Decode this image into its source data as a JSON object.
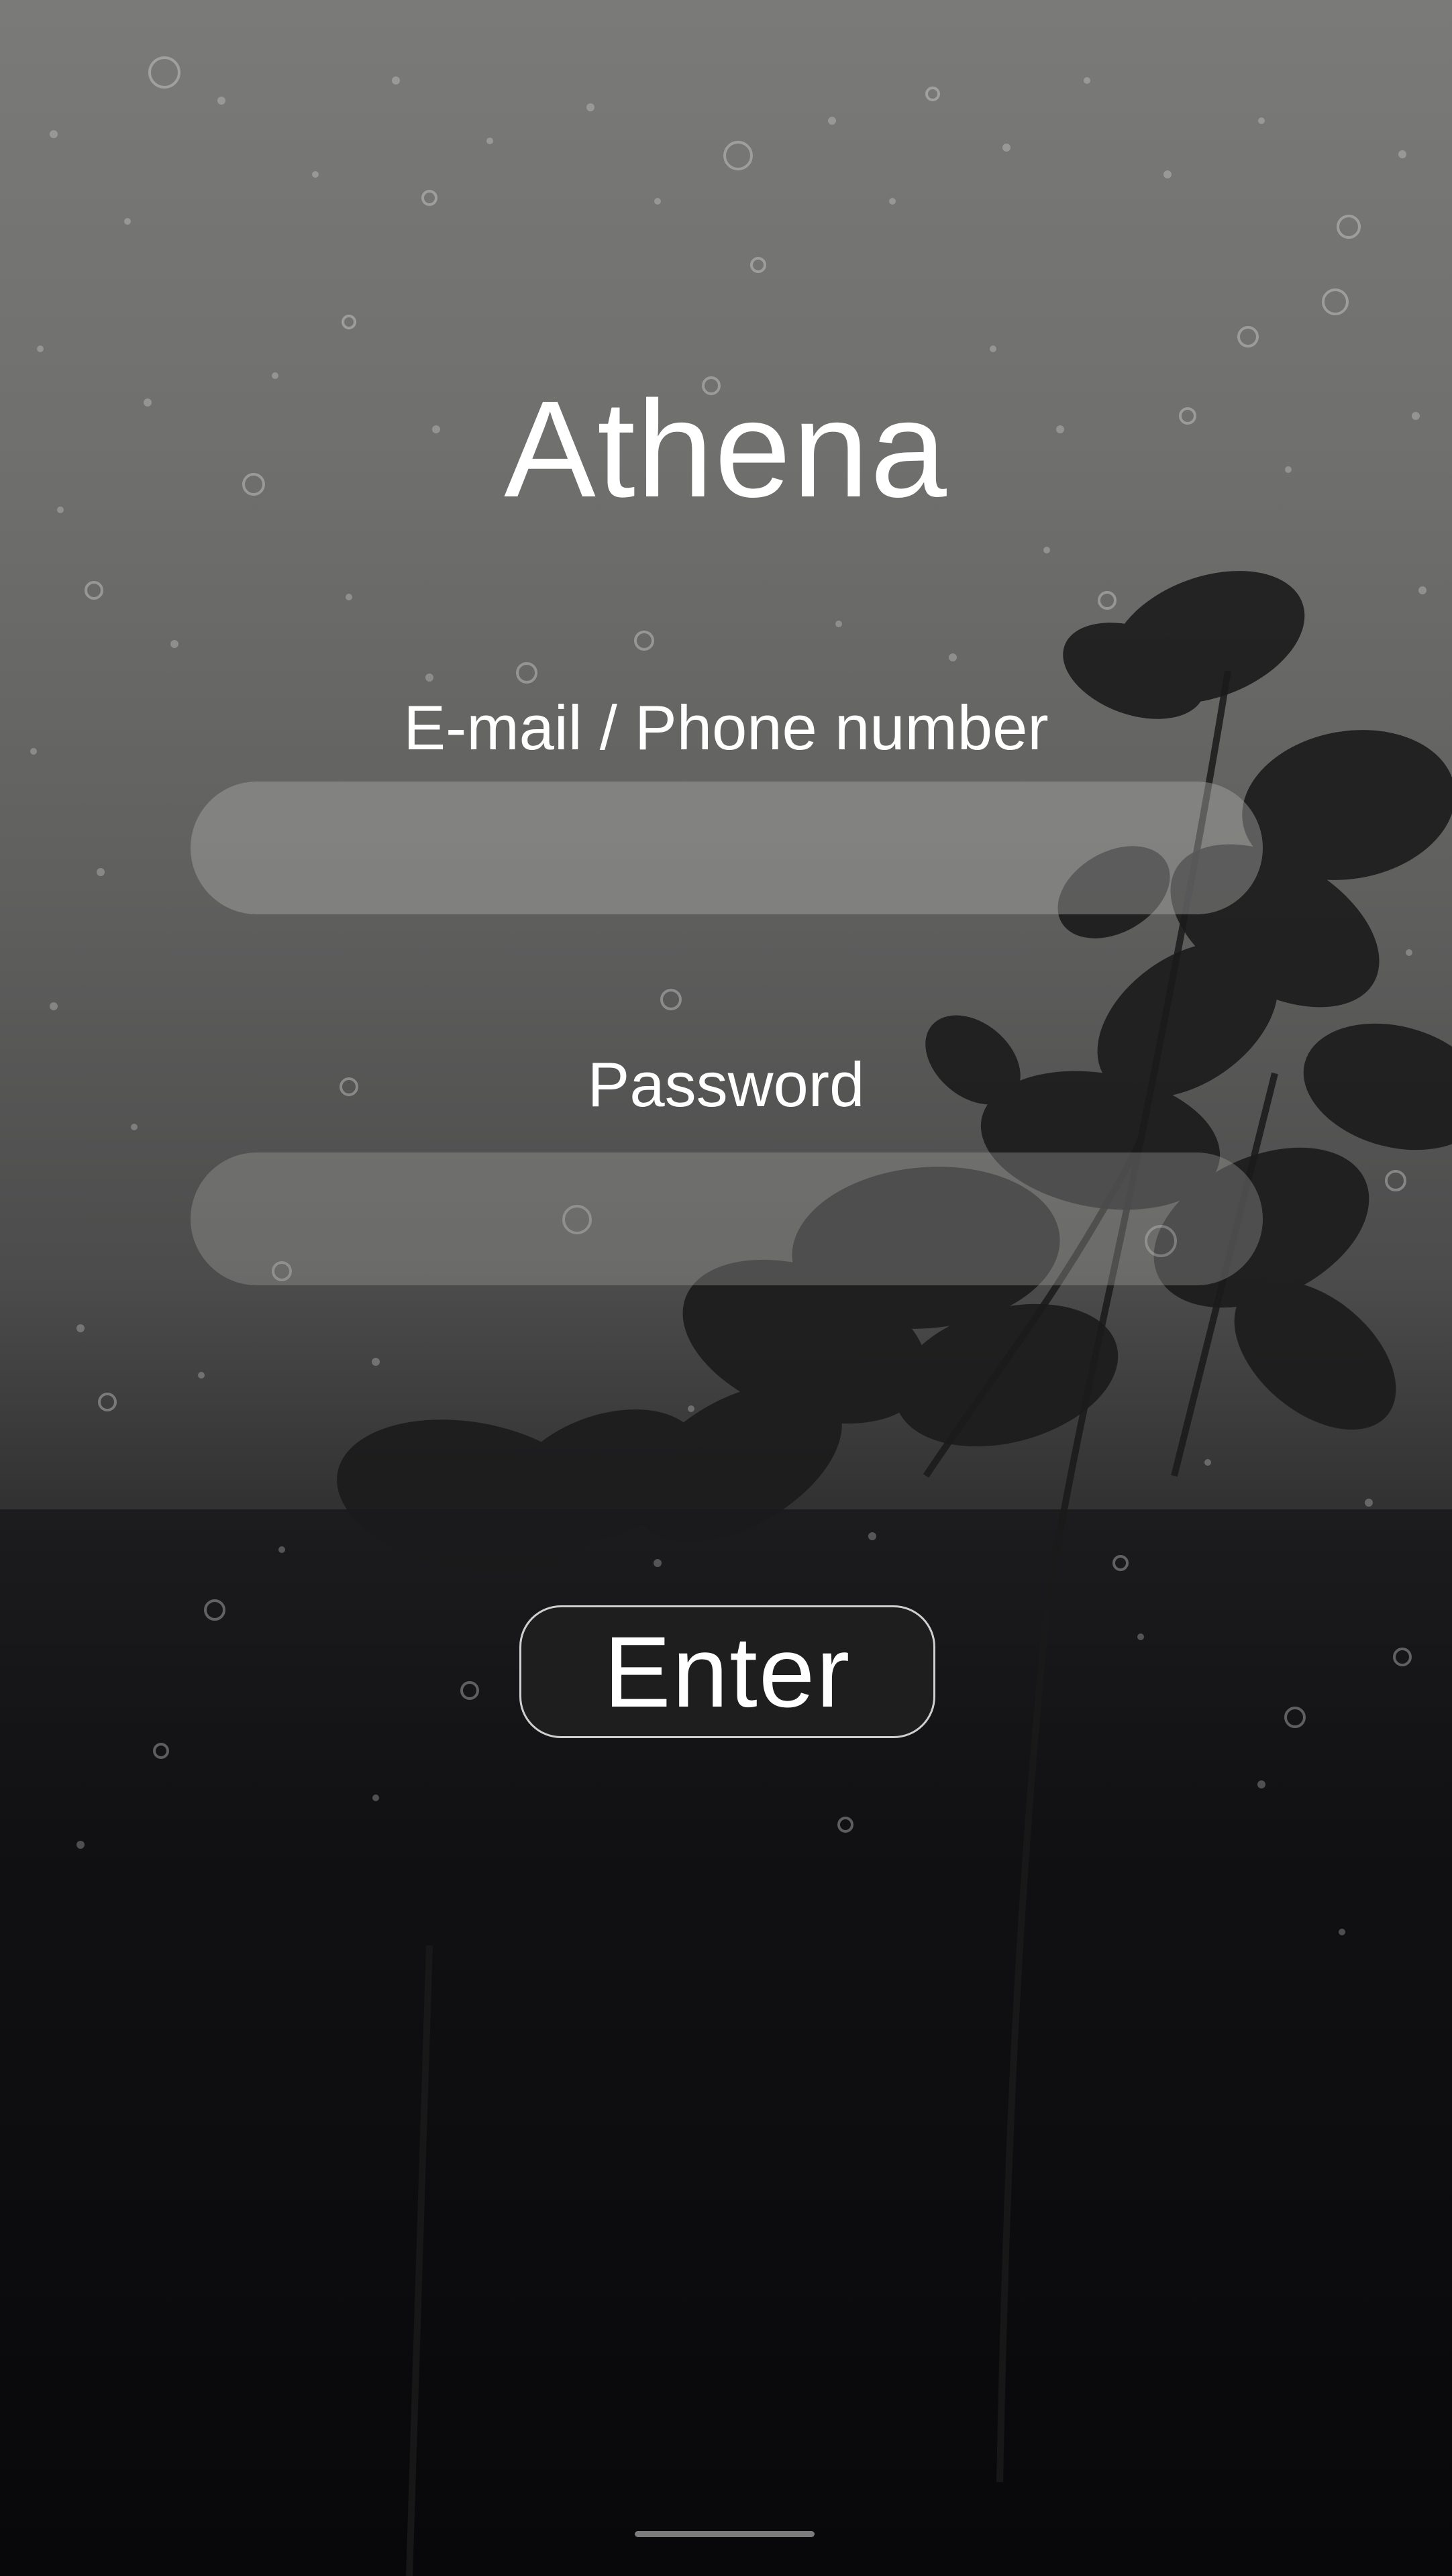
{
  "app": {
    "title": "Athena"
  },
  "form": {
    "email_label": "E-mail / Phone number",
    "email_value": "",
    "password_label": "Password",
    "password_value": "",
    "submit_label": "Enter"
  },
  "colors": {
    "text": "#ffffff",
    "input_fill": "#afafac",
    "button_fill": "#1e1e1f",
    "button_border": "#cfcfcf"
  }
}
